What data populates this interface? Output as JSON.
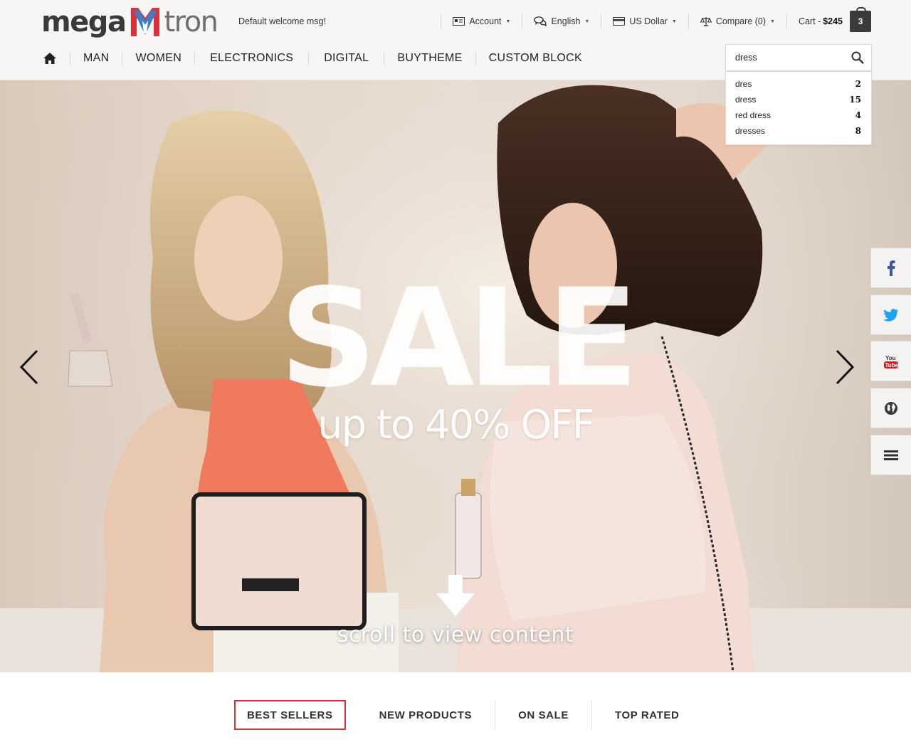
{
  "brand": {
    "left": "mega",
    "right": "tron"
  },
  "header": {
    "welcome": "Default welcome msg!",
    "account": "Account",
    "language": "English",
    "currency": "US Dollar",
    "compare": "Compare (0)",
    "cart_label": "Cart - ",
    "cart_total": "$245",
    "cart_count": "3"
  },
  "nav": {
    "items": [
      "MAN",
      "WOMEN",
      "ELECTRONICS",
      "DIGITAL",
      "BUYTHEME",
      "CUSTOM BLOCK"
    ]
  },
  "search": {
    "value": "dress",
    "suggestions": [
      {
        "term": "dres",
        "count": "2"
      },
      {
        "term": "dress",
        "count": "15"
      },
      {
        "term": "red dress",
        "count": "4"
      },
      {
        "term": "dresses",
        "count": "8"
      }
    ]
  },
  "hero": {
    "title": "SALE",
    "subtitle": "up to 40% OFF",
    "scroll_text": "scroll to view content"
  },
  "social": [
    "facebook-icon",
    "twitter-icon",
    "youtube-icon",
    "globe-icon",
    "menu-icon"
  ],
  "tabs": [
    "BEST SELLERS",
    "NEW PRODUCTS",
    "ON SALE",
    "TOP RATED"
  ],
  "colors": {
    "accent": "#d9323a",
    "logo_blue": "#3d7fc1",
    "dark": "#3b3b3b"
  }
}
